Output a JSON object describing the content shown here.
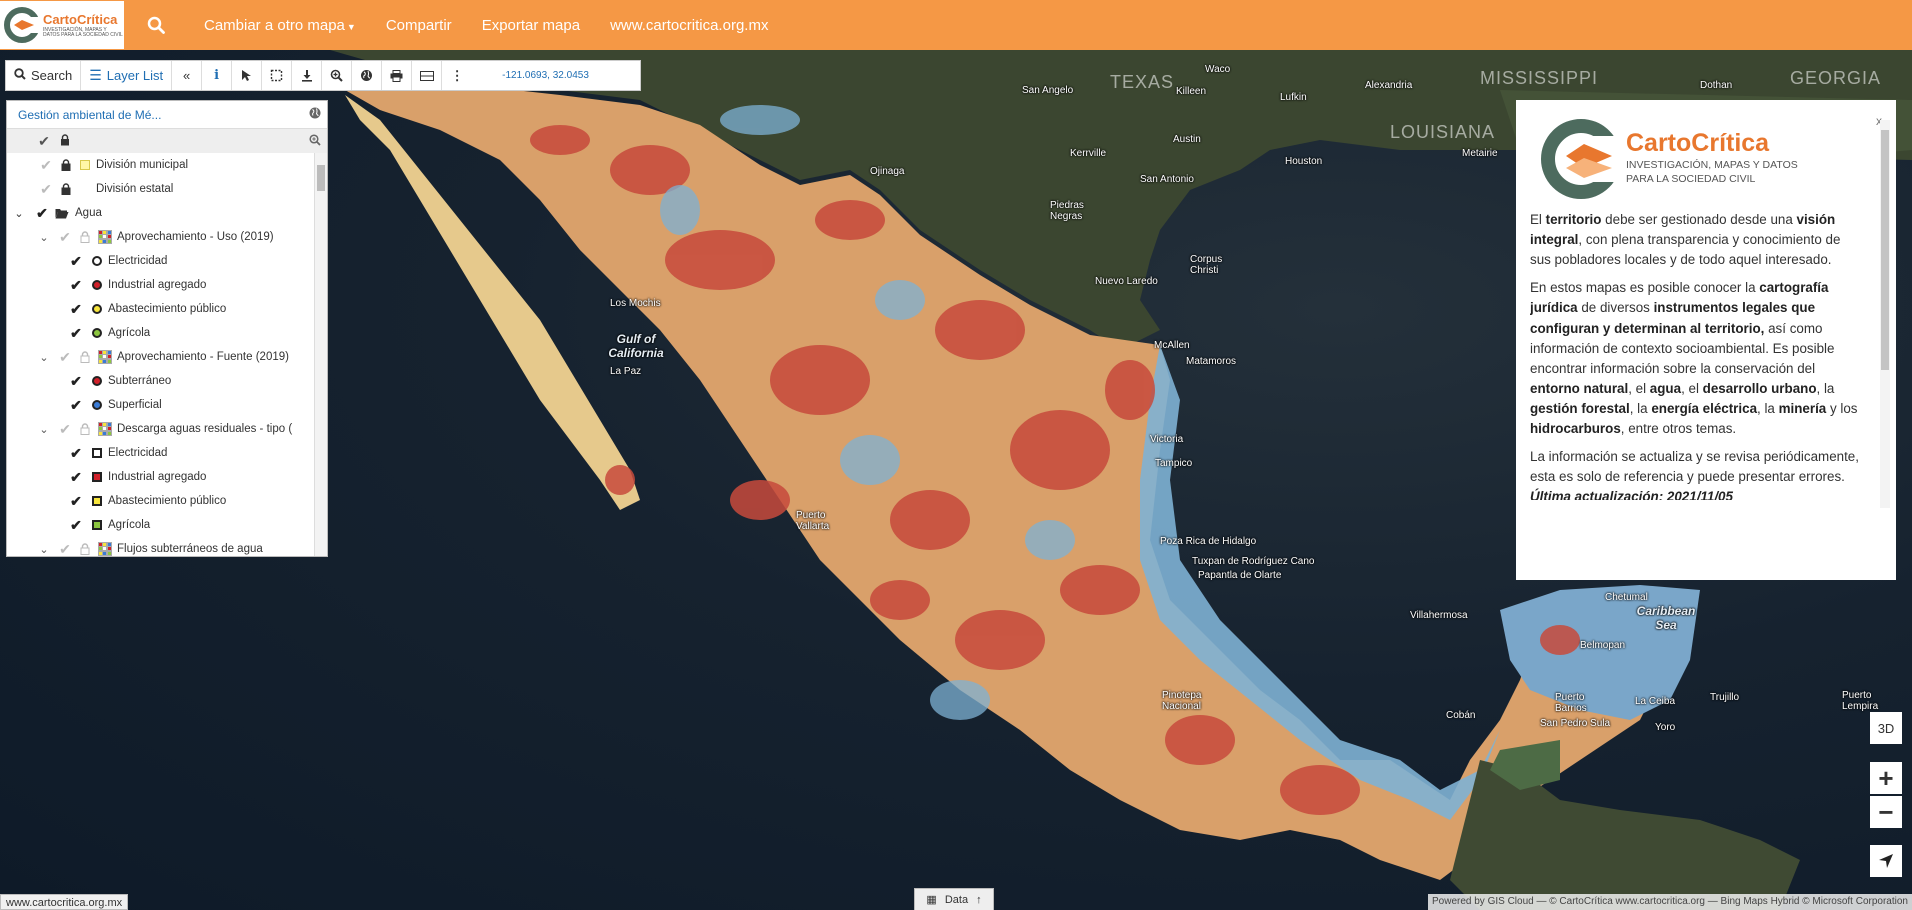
{
  "topbar": {
    "logo_name": "CartoCrítica",
    "logo_tagline": "INVESTIGACIÓN, MAPAS Y DATOS PARA LA SOCIEDAD CIVIL",
    "nav": [
      "Cambiar a otro mapa",
      "Compartir",
      "Exportar mapa",
      "www.cartocritica.org.mx"
    ]
  },
  "toolbar": {
    "search_label": "Search",
    "layerlist_label": "Layer List",
    "coords": "-121.0693, 32.0453"
  },
  "layers": {
    "map_title": "Gestión ambiental de Mé...",
    "items": [
      {
        "label": "División municipal",
        "indent": 0,
        "type": "poly",
        "color": "#fff7a8"
      },
      {
        "label": "División estatal",
        "indent": 0,
        "type": "none"
      },
      {
        "label": "Agua",
        "indent": 0,
        "type": "folder"
      },
      {
        "label": "Aprovechamiento - Uso (2019)",
        "indent": 1,
        "type": "group"
      },
      {
        "label": "Electricidad",
        "indent": 2,
        "type": "circle",
        "color": "#ffffff"
      },
      {
        "label": "Industrial agregado",
        "indent": 2,
        "type": "circle",
        "color": "#d0202a"
      },
      {
        "label": "Abastecimiento público",
        "indent": 2,
        "type": "circle",
        "color": "#f7e53c"
      },
      {
        "label": "Agrícola",
        "indent": 2,
        "type": "circle",
        "color": "#8cc63f"
      },
      {
        "label": "Aprovechamiento - Fuente (2019)",
        "indent": 1,
        "type": "group"
      },
      {
        "label": "Subterráneo",
        "indent": 2,
        "type": "circle",
        "color": "#d0202a"
      },
      {
        "label": "Superficial",
        "indent": 2,
        "type": "circle",
        "color": "#3a7bd5"
      },
      {
        "label": "Descarga aguas residuales - tipo (",
        "indent": 1,
        "type": "group"
      },
      {
        "label": "Electricidad",
        "indent": 2,
        "type": "square",
        "color": "#ffffff"
      },
      {
        "label": "Industrial agregado",
        "indent": 2,
        "type": "square",
        "color": "#d0202a"
      },
      {
        "label": "Abastecimiento público",
        "indent": 2,
        "type": "square",
        "color": "#f7e53c"
      },
      {
        "label": "Agrícola",
        "indent": 2,
        "type": "square",
        "color": "#8cc63f"
      },
      {
        "label": "Flujos subterráneos de agua",
        "indent": 1,
        "type": "group"
      }
    ]
  },
  "info": {
    "close": "x",
    "logo_name": "CartoCrítica",
    "logo_tagline": "INVESTIGACIÓN, MAPAS Y DATOS PARA LA SOCIEDAD CIVIL"
  },
  "map_labels": [
    {
      "t": "TEXAS",
      "big": true
    },
    {
      "t": "MISSISSIPPI",
      "big": true
    },
    {
      "t": "GEORGIA",
      "big": true
    },
    {
      "t": "LOUISIANA",
      "big": true
    },
    {
      "t": "San Angelo"
    },
    {
      "t": "Waco"
    },
    {
      "t": "Killeen"
    },
    {
      "t": "Lufkin"
    },
    {
      "t": "Alexandria"
    },
    {
      "t": "Dothan"
    },
    {
      "t": "Austin"
    },
    {
      "t": "Kerrville"
    },
    {
      "t": "Houston"
    },
    {
      "t": "San Antonio"
    },
    {
      "t": "Metairie"
    },
    {
      "t": "Ojinaga"
    },
    {
      "t": "Piedras Negras"
    },
    {
      "t": "Nuevo Laredo"
    },
    {
      "t": "Corpus Christi"
    },
    {
      "t": "McAllen"
    },
    {
      "t": "Matamoros"
    },
    {
      "t": "Los Mochis"
    },
    {
      "t": "La Paz"
    },
    {
      "t": "Gulf of California",
      "water": true
    },
    {
      "t": "Puerto Vallarta"
    },
    {
      "t": "Poza Rica de Hidalgo"
    },
    {
      "t": "Tuxpan de Rodríguez Cano"
    },
    {
      "t": "Papantla de Olarte"
    },
    {
      "t": "Villahermosa"
    },
    {
      "t": "Chetumal"
    },
    {
      "t": "Caribbean Sea",
      "water": true
    },
    {
      "t": "Belmopan"
    },
    {
      "t": "Puerto Barrios"
    },
    {
      "t": "La Ceiba"
    },
    {
      "t": "Trujillo"
    },
    {
      "t": "Puerto Lempira"
    },
    {
      "t": "San Pedro Sula"
    },
    {
      "t": "Yoro"
    },
    {
      "t": "Cobán"
    },
    {
      "t": "Pinotepa Nacional"
    },
    {
      "t": "Victoria"
    },
    {
      "t": "Tampico"
    }
  ],
  "controls": {
    "view3d": "3D",
    "zoom_in": "+",
    "zoom_out": "−"
  },
  "bottom": {
    "url": "www.cartocritica.org.mx",
    "data_tab": "Data",
    "attribution": "Powered by GIS Cloud — © CartoCrítica www.cartocritica.org — Bing Maps Hybrid © Microsoft Corporation"
  }
}
